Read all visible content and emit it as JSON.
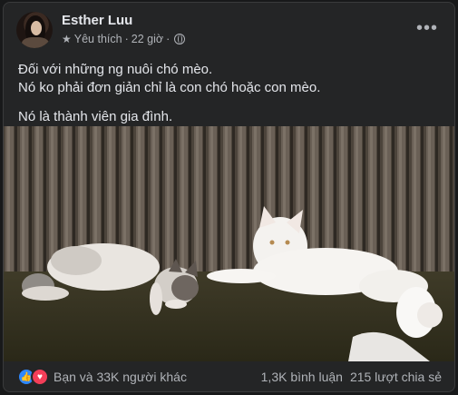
{
  "post": {
    "author": "Esther Luu",
    "audience": "Yêu thích",
    "time": "22 giờ",
    "lines": [
      "Đối với những ng nuôi chó mèo.",
      "Nó ko phải đơn giản chỉ là con chó hoặc con mèo.",
      "Nó là thành viên gia đình."
    ],
    "more_glyph": "•••"
  },
  "footer": {
    "reactions_text": "Bạn và 33K người khác",
    "comments": "1,3K bình luận",
    "shares": "215 lượt chia sẻ",
    "like_glyph": "👍",
    "love_glyph": "♥"
  },
  "icons": {
    "audience": "star-icon",
    "privacy": "globe-icon",
    "menu": "more-horizontal-icon"
  },
  "colors": {
    "card": "#242526",
    "like": "#2d88ff",
    "love": "#f33e58"
  }
}
